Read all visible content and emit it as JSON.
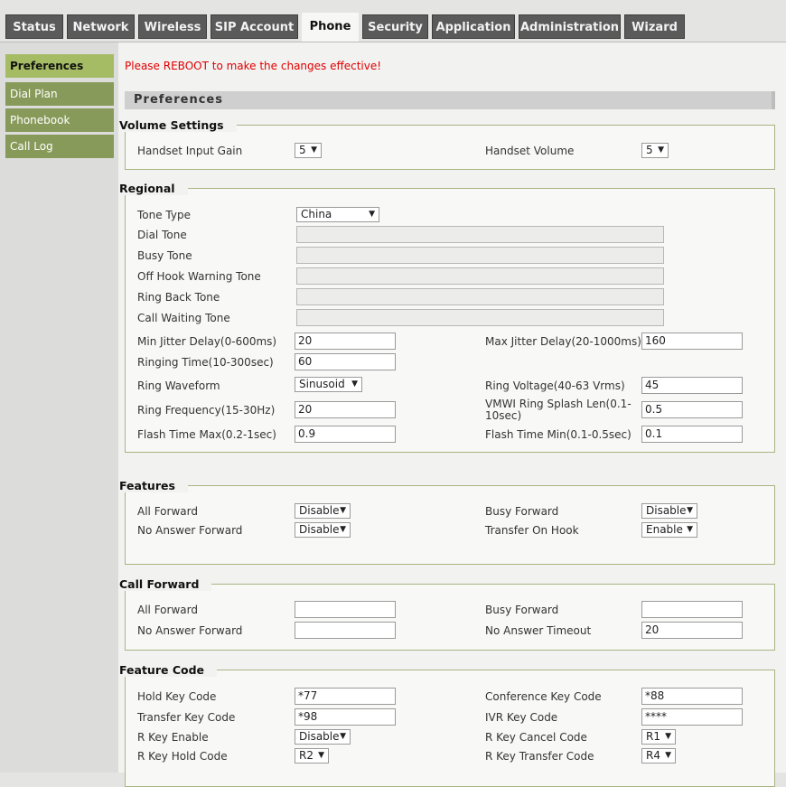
{
  "tabs": [
    "Status",
    "Network",
    "Wireless",
    "SIP Account",
    "Phone",
    "Security",
    "Application",
    "Administration",
    "Wizard"
  ],
  "sidebar": [
    "Preferences",
    "Dial Plan",
    "Phonebook",
    "Call Log"
  ],
  "notice": "Please REBOOT to make the changes effective!",
  "section_title": "Preferences",
  "volume": {
    "legend": "Volume Settings",
    "handset_input_gain_label": "Handset Input Gain",
    "handset_input_gain": "5",
    "handset_volume_label": "Handset Volume",
    "handset_volume": "5"
  },
  "regional": {
    "legend": "Regional",
    "tone_type_label": "Tone Type",
    "tone_type": "China",
    "dial_tone_label": "Dial Tone",
    "busy_tone_label": "Busy Tone",
    "off_hook_label": "Off Hook Warning Tone",
    "ring_back_label": "Ring Back Tone",
    "call_waiting_label": "Call Waiting Tone",
    "min_jitter_label": "Min Jitter Delay(0-600ms)",
    "min_jitter": "20",
    "max_jitter_label": "Max Jitter Delay(20-1000ms)",
    "max_jitter": "160",
    "ringing_time_label": "Ringing Time(10-300sec)",
    "ringing_time": "60",
    "ring_waveform_label": "Ring Waveform",
    "ring_waveform": "Sinusoid",
    "ring_voltage_label": "Ring Voltage(40-63 Vrms)",
    "ring_voltage": "45",
    "ring_freq_label": "Ring Frequency(15-30Hz)",
    "ring_freq": "20",
    "vmwi_label_1": "VMWI Ring Splash Len(0.1-",
    "vmwi_label_2": "10sec)",
    "vmwi": "0.5",
    "flash_max_label": "Flash Time Max(0.2-1sec)",
    "flash_max": "0.9",
    "flash_min_label": "Flash Time Min(0.1-0.5sec)",
    "flash_min": "0.1"
  },
  "features": {
    "legend": "Features",
    "all_forward_label": "All Forward",
    "all_forward": "Disable",
    "busy_forward_label": "Busy Forward",
    "busy_forward": "Disable",
    "no_answer_label": "No Answer Forward",
    "no_answer": "Disable",
    "transfer_label": "Transfer On Hook",
    "transfer": "Enable"
  },
  "call_forward": {
    "legend": "Call Forward",
    "all_forward_label": "All Forward",
    "all_forward": "",
    "busy_forward_label": "Busy Forward",
    "busy_forward": "",
    "no_answer_label": "No Answer Forward",
    "no_answer": "",
    "timeout_label": "No Answer Timeout",
    "timeout": "20"
  },
  "feature_code": {
    "legend": "Feature Code",
    "hold_label": "Hold Key Code",
    "hold": "*77",
    "conference_label": "Conference Key Code",
    "conference": "*88",
    "transfer_label": "Transfer Key Code",
    "transfer": "*98",
    "ivr_label": "IVR Key Code",
    "ivr": "****",
    "rkey_enable_label": "R Key Enable",
    "rkey_enable": "Disable",
    "rkey_cancel_label": "R Key Cancel Code",
    "rkey_cancel": "R1",
    "rkey_hold_label": "R Key Hold Code",
    "rkey_hold": "R2",
    "rkey_transfer_label": "R Key Transfer Code",
    "rkey_transfer": "R4"
  },
  "colors": {
    "notice": "#e00000",
    "sidebar": "#889a5a",
    "sidebar_active": "#a5bb64",
    "tab": "#5a5a5a"
  }
}
